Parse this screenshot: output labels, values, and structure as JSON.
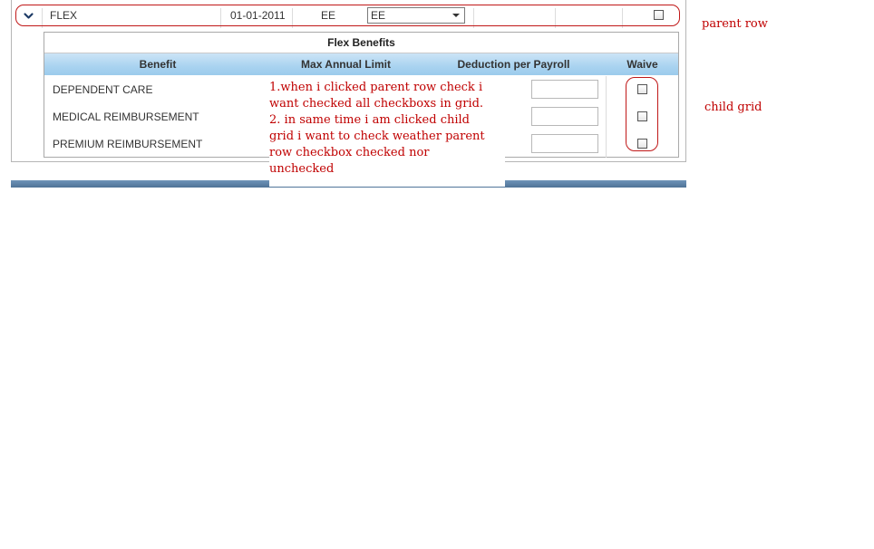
{
  "colors": {
    "header_gradient": "#a9d3f0",
    "annotation_red": "#c00000",
    "bottom_bar": "#5b80a6"
  },
  "parent_row": {
    "expand_icon": "chevron-down-icon",
    "plan": "FLEX",
    "date": "01-01-2011",
    "coverage": "EE",
    "dropdown_value": "EE",
    "checked": false
  },
  "child_grid": {
    "title": "Flex Benefits",
    "columns": {
      "benefit": "Benefit",
      "max_annual_limit": "Max Annual Limit",
      "deduction_per_payroll": "Deduction per Payroll",
      "waive": "Waive"
    },
    "rows": [
      {
        "benefit": "DEPENDENT CARE",
        "deduction": "",
        "waive": false
      },
      {
        "benefit": "MEDICAL REIMBURSEMENT",
        "deduction": "",
        "waive": false
      },
      {
        "benefit": "PREMIUM REIMBURSEMENT",
        "deduction": "",
        "waive": false
      }
    ]
  },
  "annotations": {
    "note": "1.when i clicked parent row check i\nwant checked all checkboxs in grid.\n2. in same time i am clicked child\ngrid i want to check weather parent\nrow checkbox checked nor\nunchecked",
    "parent_row_label": "parent row",
    "child_grid_label": "child grid"
  }
}
